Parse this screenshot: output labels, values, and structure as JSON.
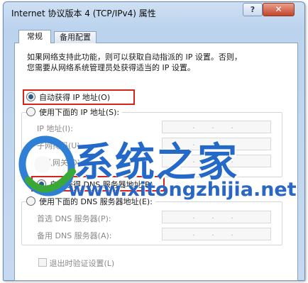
{
  "window": {
    "title": "Internet 协议版本 4 (TCP/IPv4) 属性",
    "help_label": "?",
    "close_label": "✕"
  },
  "tabs": [
    {
      "label": "常规",
      "selected": true
    },
    {
      "label": "备用配置",
      "selected": false
    }
  ],
  "description": {
    "line1": "如果网络支持此功能，则可以获取自动指派的 IP 设置。否则，",
    "line2": "您需要从网络系统管理员处获得适当的 IP 设置。"
  },
  "ip_section": {
    "auto_label": "自动获得 IP 地址(O)",
    "auto_selected": true,
    "manual_label": "使用下面的 IP 地址(S):",
    "manual_selected": false,
    "fields": [
      {
        "label": "IP 地址(I):",
        "value": ". . ."
      },
      {
        "label": "子网掩码(U):",
        "value": ". . ."
      },
      {
        "label": "默认网关(D):",
        "value": ". . ."
      }
    ]
  },
  "dns_section": {
    "auto_label": "自动获得 DNS 服务器地址(B)",
    "auto_selected": true,
    "manual_label": "使用下面的 DNS 服务器地址(E):",
    "manual_selected": false,
    "fields": [
      {
        "label": "首选 DNS 服务器(P):",
        "value": ". . ."
      },
      {
        "label": "备用 DNS 服务器(A):",
        "value": ". . ."
      }
    ]
  },
  "validate": {
    "label": "退出时验证设置(L)",
    "checked": false
  },
  "watermark": {
    "name": "系统之家",
    "url": "www.xitongzhijia.net"
  },
  "colors": {
    "highlight_border": "#d4241c",
    "watermark_blue": "#2468c8"
  }
}
